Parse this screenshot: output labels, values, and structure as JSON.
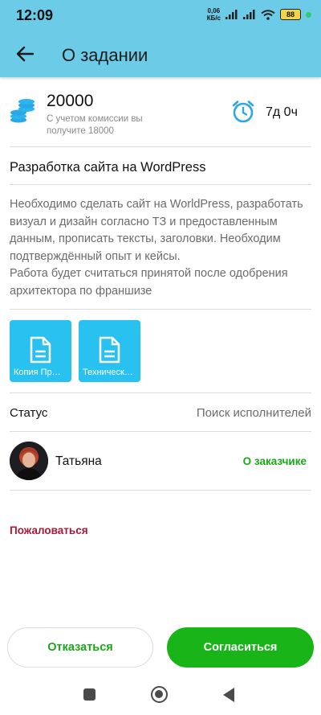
{
  "status_bar": {
    "time": "12:09",
    "net_speed_value": "0,06",
    "net_speed_unit": "КБ/с",
    "battery": "88",
    "accent": "#6ccbe6"
  },
  "header": {
    "title": "О задании",
    "back_icon": "arrow-left-icon"
  },
  "reward": {
    "amount": "20000",
    "note": "С учетом комиссии вы получите 18000",
    "time_left": "7д 0ч",
    "coin_color": "#29a7e6"
  },
  "task": {
    "title": "Разработка сайта на WordPress",
    "description": "Необходимо сделать сайт на WorldPress, разработать визуал и дизайн согласно ТЗ и предоставленным данным, прописать тексты, заголовки. Необходим подтверждённый опыт и кейсы.\nРабота будет считаться принятой после одобрения архитектора по франшизе"
  },
  "files": [
    {
      "name": "Копия Пр…",
      "icon": "document-icon"
    },
    {
      "name": "Техническ…",
      "icon": "document-icon"
    }
  ],
  "status": {
    "label": "Статус",
    "value": "Поиск исполнителей"
  },
  "customer": {
    "name": "Татьяна",
    "link_label": "О заказчике",
    "link_color": "#18a818"
  },
  "complain_label": "Пожаловаться",
  "actions": {
    "decline_label": "Отказаться",
    "accept_label": "Согласиться",
    "accept_color": "#18b418"
  }
}
